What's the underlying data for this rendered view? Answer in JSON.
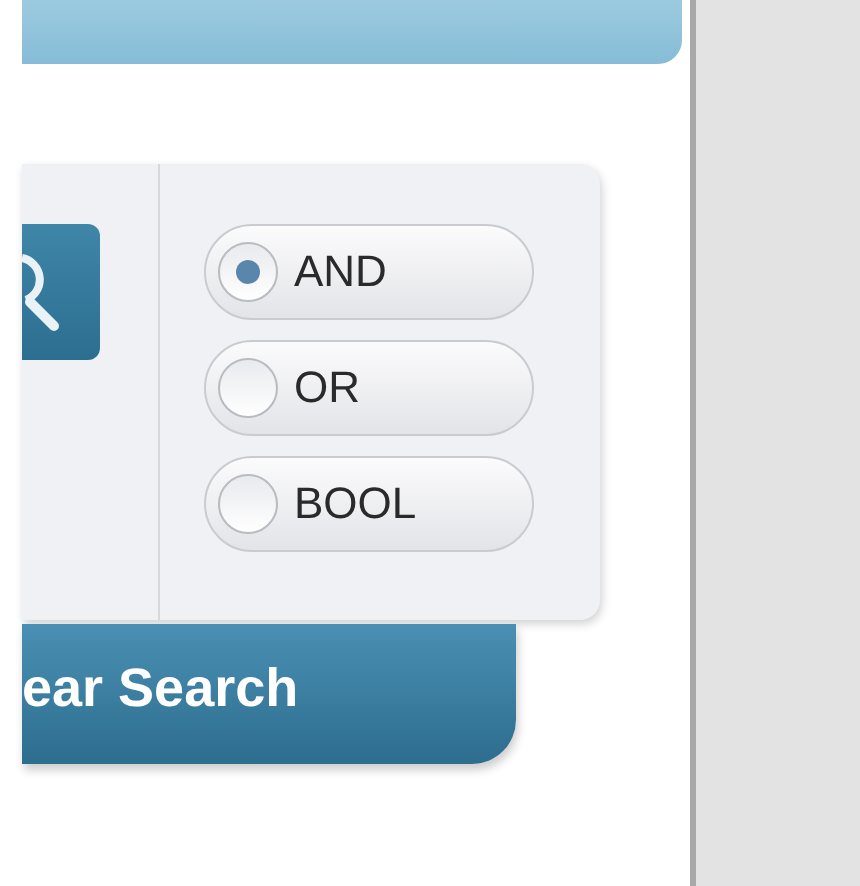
{
  "operators": [
    {
      "label": "AND",
      "selected": true
    },
    {
      "label": "OR",
      "selected": false
    },
    {
      "label": "BOOL",
      "selected": false
    }
  ],
  "clear_button": {
    "label": "ear Search"
  }
}
